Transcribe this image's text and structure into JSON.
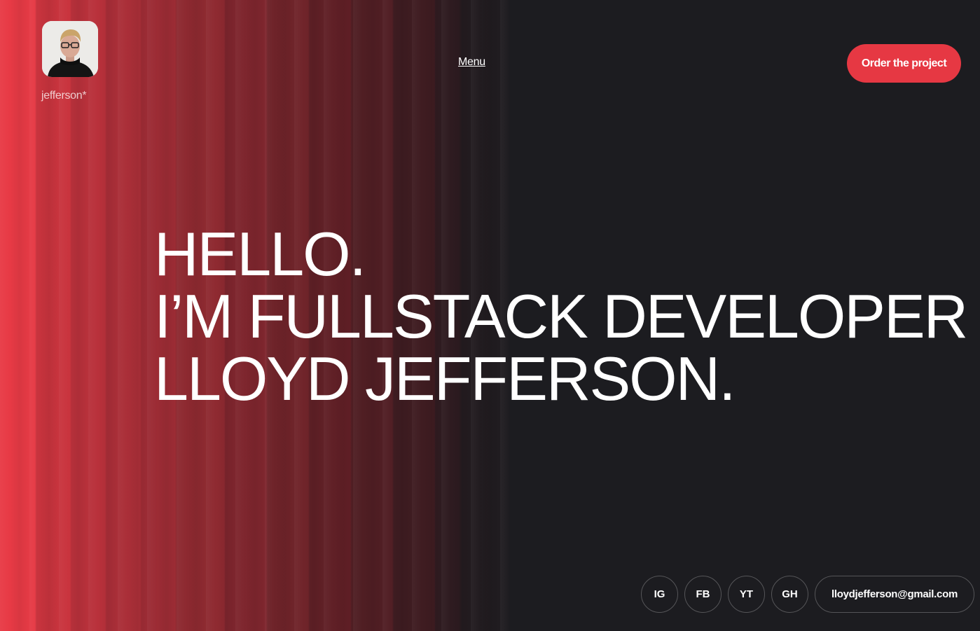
{
  "header": {
    "brand_name": "jefferson*",
    "menu_label": "Menu",
    "order_button_label": "Order the project",
    "avatar_icon": "profile-photo"
  },
  "hero": {
    "line1": "HELLO.",
    "line2": "I’M FULLSTACK DEVELOPER",
    "line3": "LLOYD JEFFERSON."
  },
  "socials": [
    {
      "label": "IG"
    },
    {
      "label": "FB"
    },
    {
      "label": "YT"
    },
    {
      "label": "GH"
    }
  ],
  "contact": {
    "email": "lloydjefferson@gmail.com"
  },
  "colors": {
    "accent": "#e63843",
    "background": "#1c1c20",
    "text": "#ffffff"
  }
}
